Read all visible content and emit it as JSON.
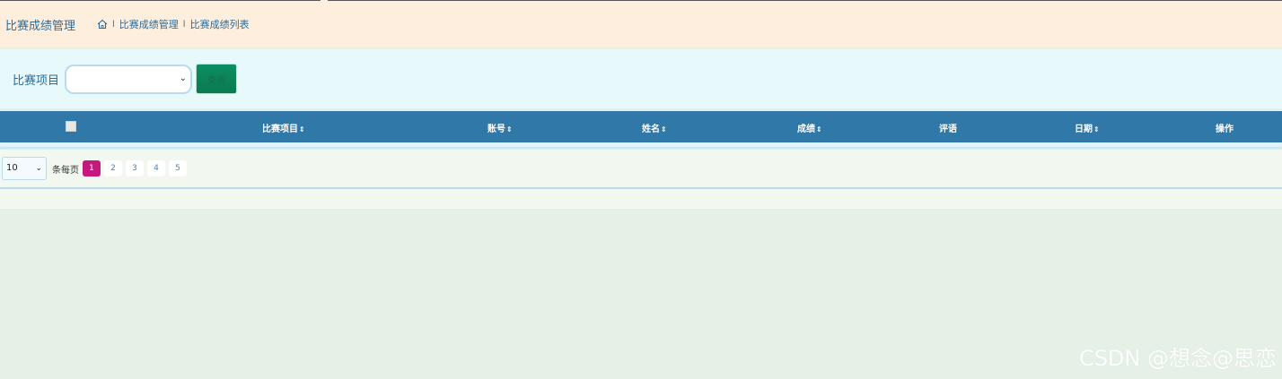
{
  "header": {
    "title": "比赛成绩管理",
    "breadcrumb": {
      "home_icon": "home-icon",
      "separator": "l",
      "items": [
        "比赛成绩管理",
        "比赛成绩列表"
      ]
    }
  },
  "search": {
    "label": "比赛项目",
    "select_value": "",
    "button_label": "查询"
  },
  "table": {
    "columns": [
      {
        "label": "比赛项目",
        "sortable": true
      },
      {
        "label": "账号",
        "sortable": true
      },
      {
        "label": "姓名",
        "sortable": true
      },
      {
        "label": "成绩",
        "sortable": true
      },
      {
        "label": "评语",
        "sortable": false
      },
      {
        "label": "日期",
        "sortable": true
      },
      {
        "label": "操作",
        "sortable": false
      }
    ],
    "sort_icon": "⇕",
    "rows": []
  },
  "pagination": {
    "page_size": "10",
    "per_page_label": "条每页",
    "pages": [
      "1",
      "2",
      "3",
      "4",
      "5"
    ],
    "current": "1"
  },
  "watermark": "CSDN @想念@思恋",
  "colors": {
    "header_bg": "#fdeedd",
    "table_header": "#2f78a8",
    "active_page": "#c8177d",
    "search_button": "#0c8e62"
  }
}
